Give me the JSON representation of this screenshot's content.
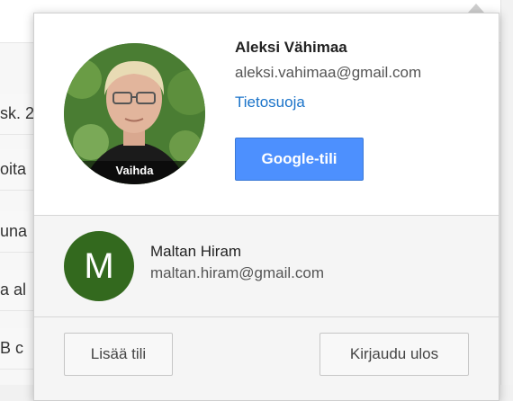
{
  "background": {
    "rows": [
      "sk. 2",
      "oita",
      "una",
      "a al",
      "B c"
    ]
  },
  "primary_account": {
    "name": "Aleksi Vähimaa",
    "email": "aleksi.vahimaa@gmail.com",
    "privacy_link": "Tietosuoja",
    "avatar_change_label": "Vaihda",
    "google_account_button": "Google-tili"
  },
  "secondary_account": {
    "avatar_letter": "M",
    "name": "Maltan Hiram",
    "email": "maltan.hiram@gmail.com"
  },
  "footer": {
    "add_account": "Lisää tili",
    "sign_out": "Kirjaudu ulos"
  },
  "colors": {
    "primary_button": "#4d90fe",
    "link": "#1a73c9",
    "secondary_avatar": "#33691e"
  }
}
